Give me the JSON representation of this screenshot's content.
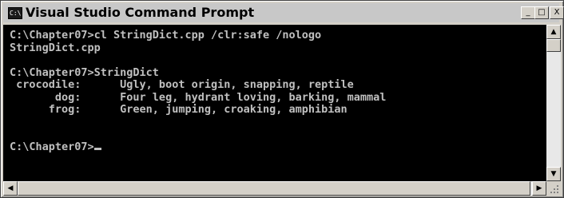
{
  "window": {
    "title": "Visual Studio Command Prompt",
    "app_icon_text": "C:\\"
  },
  "title_buttons": {
    "minimize": "_",
    "maximize": "□",
    "close": "X"
  },
  "console": {
    "lines": [
      "C:\\Chapter07>cl StringDict.cpp /clr:safe /nologo",
      "StringDict.cpp",
      "",
      "C:\\Chapter07>StringDict",
      " crocodile:      Ugly, boot origin, snapping, reptile",
      "       dog:      Four leg, hydrant loving, barking, mammal",
      "      frog:      Green, jumping, croaking, amphibian",
      "",
      "",
      "C:\\Chapter07>"
    ]
  },
  "scrollbars": {
    "up_arrow": "▲",
    "down_arrow": "▼",
    "left_arrow": "◀",
    "right_arrow": "▶"
  }
}
